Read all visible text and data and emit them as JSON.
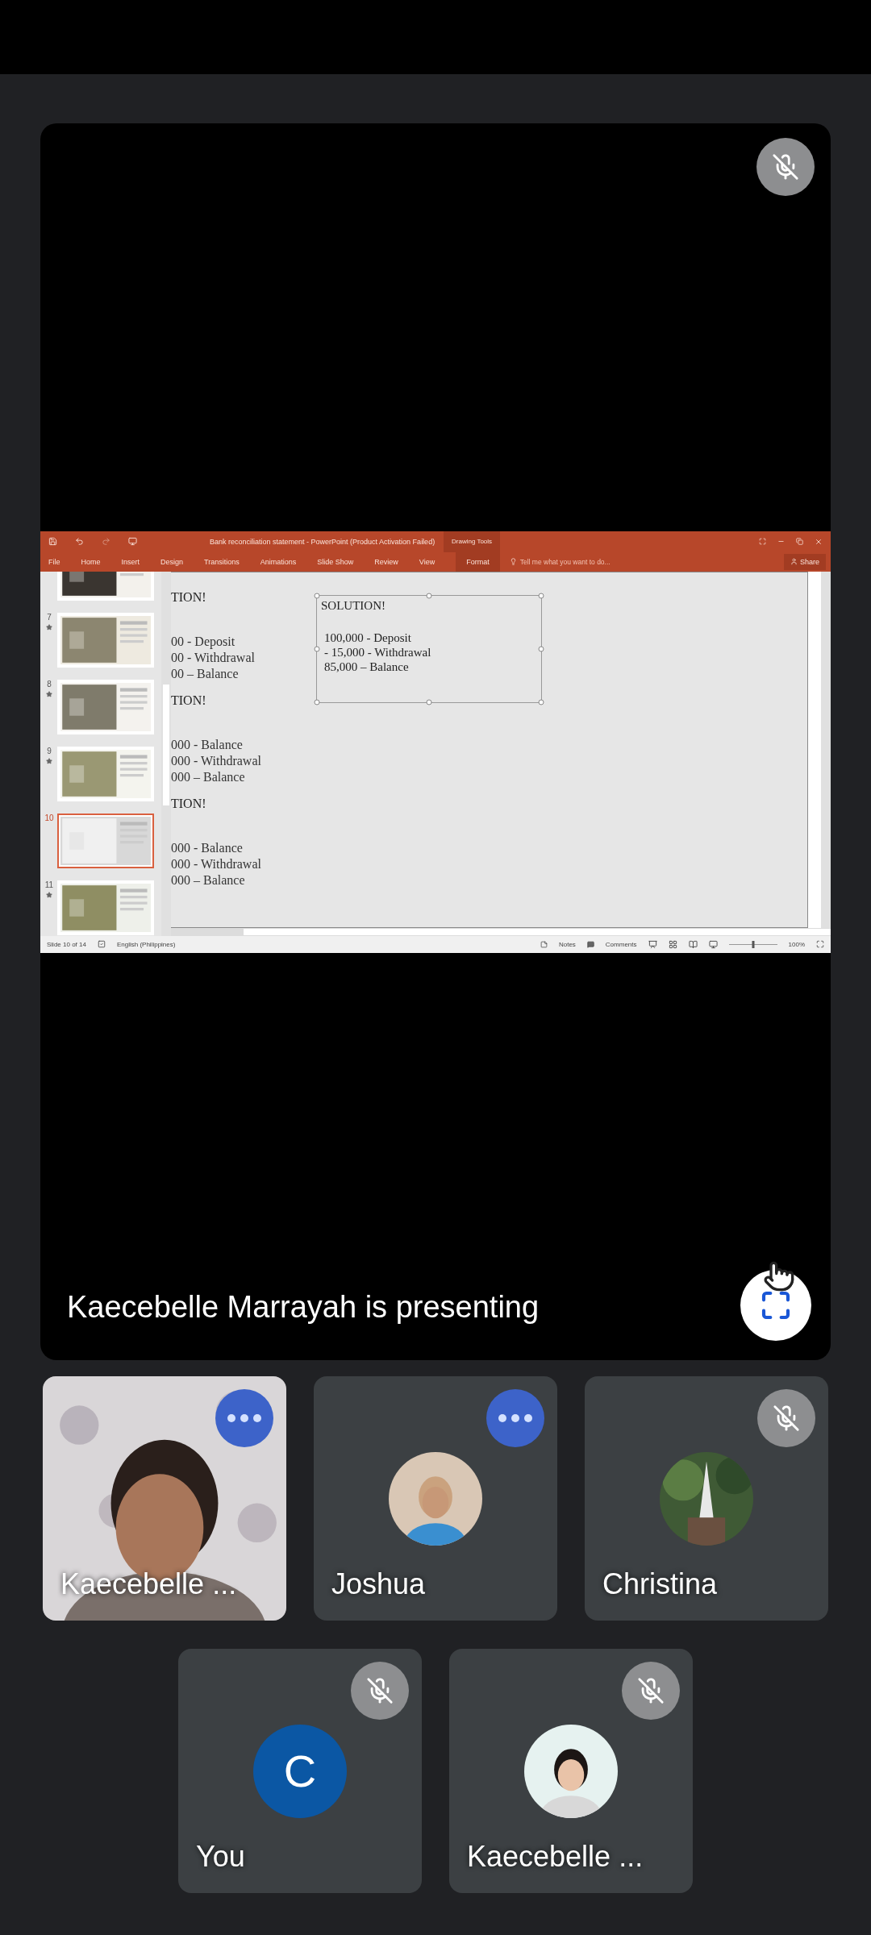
{
  "presentation": {
    "muted": true,
    "caption": "Kaecebelle Marrayah is presenting",
    "shared_window": {
      "title": "Bank reconciliation statement - PowerPoint (Product Activation Failed)",
      "tool_group": "Drawing Tools",
      "tabs": [
        {
          "label": "File",
          "contextual": false
        },
        {
          "label": "Home",
          "contextual": false
        },
        {
          "label": "Insert",
          "contextual": false
        },
        {
          "label": "Design",
          "contextual": false
        },
        {
          "label": "Transitions",
          "contextual": false
        },
        {
          "label": "Animations",
          "contextual": false
        },
        {
          "label": "Slide Show",
          "contextual": false
        },
        {
          "label": "Review",
          "contextual": false
        },
        {
          "label": "View",
          "contextual": false
        },
        {
          "label": "Format",
          "contextual": true
        }
      ],
      "tell_me": {
        "placeholder": "Tell me what you want to do..."
      },
      "share_button": "Share",
      "slides": [
        {
          "selected": false,
          "animated": false
        },
        {
          "number": "7",
          "selected": false,
          "animated": true
        },
        {
          "number": "8",
          "selected": false,
          "animated": true
        },
        {
          "number": "9",
          "selected": false,
          "animated": true
        },
        {
          "number": "10",
          "selected": true,
          "animated": false
        },
        {
          "number": "11",
          "selected": false,
          "animated": true
        }
      ],
      "slide_blocks": [
        {
          "heading": "TION!",
          "lines": [
            "00 - Deposit",
            "00 - Withdrawal",
            "00 – Balance"
          ]
        },
        {
          "heading": "TION!",
          "lines": [
            "000 - Balance",
            "000 - Withdrawal",
            "000 – Balance"
          ]
        },
        {
          "heading": "TION!",
          "lines": [
            "000 - Balance",
            "000 - Withdrawal",
            "000 – Balance"
          ]
        }
      ],
      "text_box": {
        "heading": "SOLUTION!",
        "lines": [
          "100,000 - Deposit",
          "-  15,000 - Withdrawal",
          "85,000 – Balance"
        ]
      },
      "status": {
        "slide": "Slide 10 of 14",
        "language": "English (Philippines)",
        "notes": "Notes",
        "comments": "Comments",
        "zoom": "100%",
        "zoom_slider": {
          "level": 0.5
        }
      }
    }
  },
  "participants": [
    {
      "name": "Kaecebelle ...",
      "muted": false,
      "kind": "video"
    },
    {
      "name": "Joshua",
      "muted": false
    },
    {
      "name": "Christina",
      "muted": true
    },
    {
      "name": "You",
      "muted": true,
      "kind": "initial",
      "initial": "C",
      "color": "#0b57a4"
    },
    {
      "name": "Kaecebelle ...",
      "muted": true
    }
  ]
}
